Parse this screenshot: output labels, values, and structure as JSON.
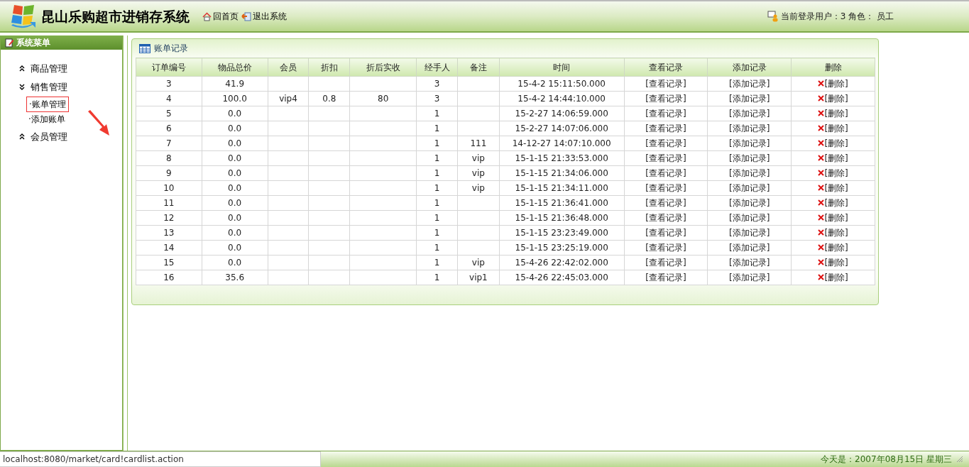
{
  "header": {
    "title": "昆山乐购超市进销存系统",
    "links": [
      "回首页",
      "退出系统"
    ],
    "user_info": "当前登录用户：3 角色：  员工"
  },
  "sidebar": {
    "title": "系统菜单",
    "items": [
      {
        "label": "商品管理",
        "expanded": false
      },
      {
        "label": "销售管理",
        "expanded": true,
        "children": [
          {
            "label": "·账单管理",
            "selected": true
          },
          {
            "label": "·添加账单",
            "selected": false
          }
        ]
      },
      {
        "label": "会员管理",
        "expanded": false
      }
    ]
  },
  "panel": {
    "title": "账单记录"
  },
  "table": {
    "columns": [
      "订单编号",
      "物品总价",
      "会员",
      "折扣",
      "折后实收",
      "经手人",
      "备注",
      "时间",
      "查看记录",
      "添加记录",
      "删除"
    ],
    "rows": [
      [
        "3",
        "41.9",
        "",
        "",
        "",
        "3",
        "",
        "15-4-2 15:11:50.000",
        "[查看记录]",
        "[添加记录]",
        "[删除]"
      ],
      [
        "4",
        "100.0",
        "vip4",
        "0.8",
        "80",
        "3",
        "",
        "15-4-2 14:44:10.000",
        "[查看记录]",
        "[添加记录]",
        "[删除]"
      ],
      [
        "5",
        "0.0",
        "",
        "",
        "",
        "1",
        "",
        "15-2-27 14:06:59.000",
        "[查看记录]",
        "[添加记录]",
        "[删除]"
      ],
      [
        "6",
        "0.0",
        "",
        "",
        "",
        "1",
        "",
        "15-2-27 14:07:06.000",
        "[查看记录]",
        "[添加记录]",
        "[删除]"
      ],
      [
        "7",
        "0.0",
        "",
        "",
        "",
        "1",
        "111",
        "14-12-27 14:07:10.000",
        "[查看记录]",
        "[添加记录]",
        "[删除]"
      ],
      [
        "8",
        "0.0",
        "",
        "",
        "",
        "1",
        "vip",
        "15-1-15 21:33:53.000",
        "[查看记录]",
        "[添加记录]",
        "[删除]"
      ],
      [
        "9",
        "0.0",
        "",
        "",
        "",
        "1",
        "vip",
        "15-1-15 21:34:06.000",
        "[查看记录]",
        "[添加记录]",
        "[删除]"
      ],
      [
        "10",
        "0.0",
        "",
        "",
        "",
        "1",
        "vip",
        "15-1-15 21:34:11.000",
        "[查看记录]",
        "[添加记录]",
        "[删除]"
      ],
      [
        "11",
        "0.0",
        "",
        "",
        "",
        "1",
        "",
        "15-1-15 21:36:41.000",
        "[查看记录]",
        "[添加记录]",
        "[删除]"
      ],
      [
        "12",
        "0.0",
        "",
        "",
        "",
        "1",
        "",
        "15-1-15 21:36:48.000",
        "[查看记录]",
        "[添加记录]",
        "[删除]"
      ],
      [
        "13",
        "0.0",
        "",
        "",
        "",
        "1",
        "",
        "15-1-15 23:23:49.000",
        "[查看记录]",
        "[添加记录]",
        "[删除]"
      ],
      [
        "14",
        "0.0",
        "",
        "",
        "",
        "1",
        "",
        "15-1-15 23:25:19.000",
        "[查看记录]",
        "[添加记录]",
        "[删除]"
      ],
      [
        "15",
        "0.0",
        "",
        "",
        "",
        "1",
        "vip",
        "15-4-26 22:42:02.000",
        "[查看记录]",
        "[添加记录]",
        "[删除]"
      ],
      [
        "16",
        "35.6",
        "",
        "",
        "",
        "1",
        "vip1",
        "15-4-26 22:45:03.000",
        "[查看记录]",
        "[添加记录]",
        "[删除]"
      ]
    ]
  },
  "status_url": "localhost:8080/market/card!cardlist.action",
  "footer": {
    "date": "今天是：2007年08月15日 星期三"
  }
}
